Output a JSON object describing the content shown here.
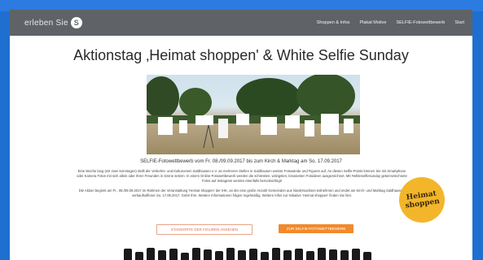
{
  "navbar": {
    "logo_text": "erleben Sie",
    "items": [
      "Shoppen & Infos",
      "Plakat Motive",
      "SELFIE-Fotowettbewerb",
      "Start"
    ]
  },
  "page_title": "Aktionstag ‚Heimat shoppen' & White Selfie Sunday",
  "subtitle": "SELFIE-Fotowettbewerb vom Fr. 08./09.09.2017 bis zum Kirch & Marktag am So. 17.09.2017",
  "paragraph1": "Eine Woche lang (mit zwei Sonntagen) stellt der Verkehrs- und Kulturverein Saldhausen e.V. an mehreren Stellen in Saldhausen weisse Fotowände und Figuren auf. An diesen Selfie-Points können Sie mit Smartphone oder Kamera Fotos mit sich allein oder Ihren Freunden in Szene setzen. In einem Online-Fotowettbewerb werden die schönsten, witzigsten, kreativsten Fotoideen ausgezeichnet. Mit #whiteselfiesunday gekennzeichnete Fotos auf Instagram werden ebenfalls berücksichtigt!",
  "paragraph2": "Die Aktion beginnt am Fr., 08./09.09.2017 im Rahmen der Veranstaltung 'Heimat shoppen' der IHK, an der eine große Anzahl Gemeinden aus Niedersachsen teilnehmen und endet am Kirch- und Marktag Saldhausen, verkaufsoffener So. 17.09.2017. Gebt! Ihre. Weitere Informationen folgen regelmäßig. Weitere Infos zur Initiative 'Heimat shoppen' finden Sie hier.",
  "badge": {
    "line1": "Heimat",
    "line2": "shoppen"
  },
  "buttons": {
    "locations": "STANDORTE DER FIGUREN ANSEHEN",
    "upload": "ZUR SELFIE-FOTOWETTBEWERB"
  },
  "colors": {
    "accent": "#f08a2c",
    "nav_bg": "#5f6368",
    "badge": "#f3b62a"
  }
}
